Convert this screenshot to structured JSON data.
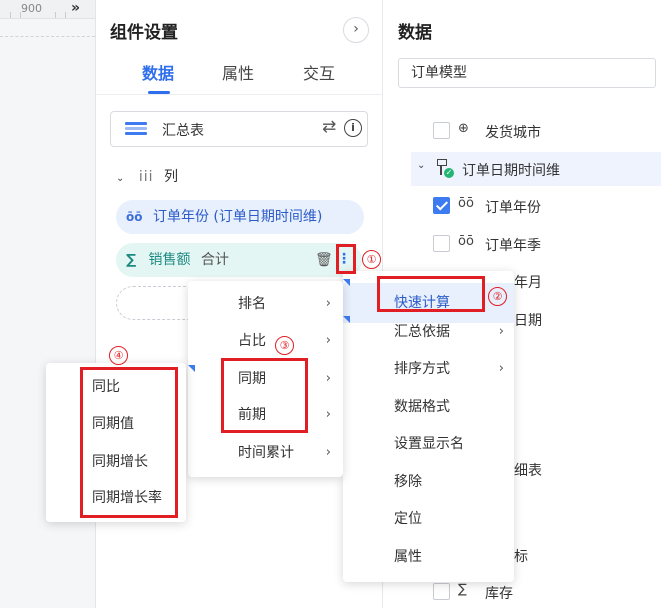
{
  "ruler": {
    "number": "900",
    "collapse_glyph": "»"
  },
  "settings": {
    "title": "组件设置",
    "collapse_glyph": "›",
    "tabs": [
      {
        "label": "数据",
        "active": true
      },
      {
        "label": "属性",
        "active": false
      },
      {
        "label": "交互",
        "active": false
      }
    ],
    "source": {
      "label": "汇总表",
      "swap_glyph": "⇄",
      "info_glyph": "i"
    },
    "columns": {
      "chevron": "⌄",
      "icon_text": "iii",
      "label": "列",
      "dimension_pill": {
        "icon_text": "ōō",
        "label": "订单年份 (订单日期时间维)"
      },
      "measure_pill": {
        "sigma": "∑",
        "label": "销售额",
        "aggregation": "合计"
      },
      "trash_glyph": "🗑",
      "more_glyph": "⋮"
    }
  },
  "data_panel": {
    "title": "数据",
    "model_input_value": "订单模型",
    "rows": {
      "city": {
        "label": "发货城市",
        "icon_text": "⊕",
        "checked": false
      },
      "date_dim": {
        "label": "订单日期时间维",
        "chevron": "⌄",
        "check_glyph": "✓"
      },
      "year": {
        "label": "订单年份",
        "icon_text": "ōō",
        "checked": true
      },
      "season": {
        "label": "订单年季",
        "icon_text": "ōō",
        "checked": false
      },
      "stock": {
        "label": "库存",
        "icon_text": "∑",
        "checked": false
      }
    },
    "ghost_text": {
      "month_suffix": "年月",
      "date_suffix": "日期",
      "table_suffix": "细表",
      "mark_suffix": "标"
    }
  },
  "menus": {
    "main_menu": {
      "highlighted": "快速计算",
      "items": [
        {
          "label": "汇总依据",
          "submenu": true
        },
        {
          "label": "排序方式",
          "submenu": true
        },
        {
          "label": "数据格式",
          "submenu": false
        },
        {
          "label": "设置显示名",
          "submenu": false
        },
        {
          "label": "移除",
          "submenu": false
        },
        {
          "label": "定位",
          "submenu": false
        },
        {
          "label": "属性",
          "submenu": false
        }
      ]
    },
    "quick_calc_menu": {
      "items": [
        {
          "label": "排名",
          "submenu": true
        },
        {
          "label": "占比",
          "submenu": true
        },
        {
          "label": "同期",
          "submenu": true
        },
        {
          "label": "前期",
          "submenu": true
        },
        {
          "label": "时间累计",
          "submenu": true
        }
      ],
      "arrow_glyph": "›"
    },
    "same_period_menu": {
      "items": [
        "同比",
        "同期值",
        "同期增长",
        "同期增长率"
      ]
    }
  },
  "annotations": [
    "①",
    "②",
    "③",
    "④"
  ],
  "colors": {
    "accent": "#2f6fed",
    "annotation_red": "#e21e25",
    "measure_green": "#1d8a80"
  }
}
